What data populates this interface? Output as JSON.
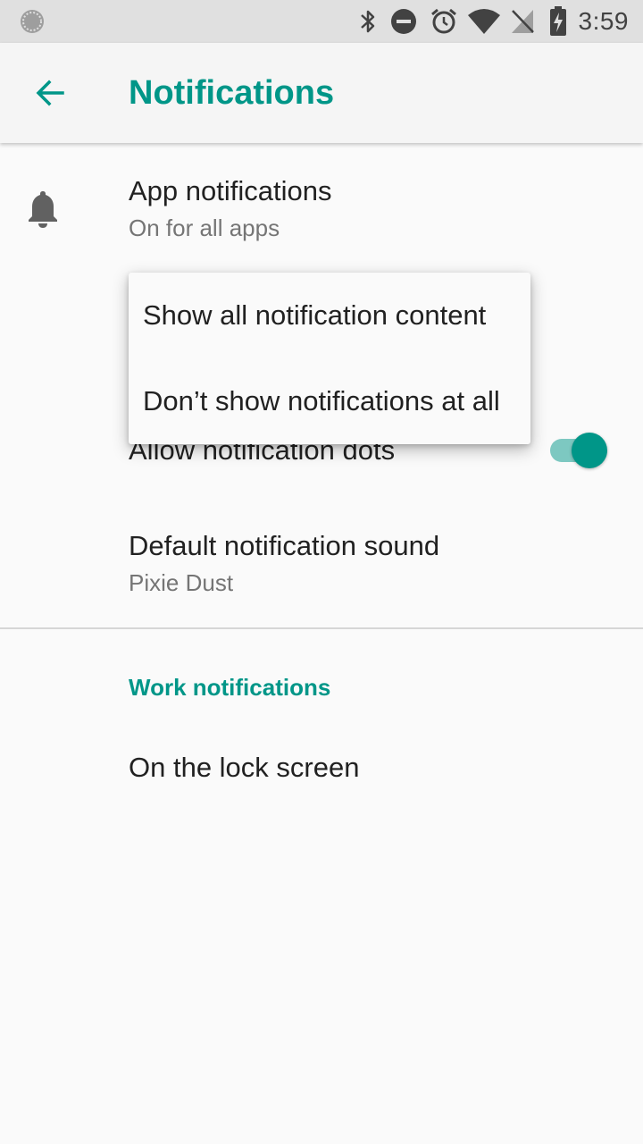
{
  "status_bar": {
    "time": "3:59",
    "icons": [
      "sync-icon",
      "bluetooth-icon",
      "do-not-disturb-icon",
      "alarm-icon",
      "wifi-icon",
      "no-signal-icon",
      "battery-charging-icon"
    ]
  },
  "toolbar": {
    "back_icon": "arrow-back-icon",
    "title": "Notifications"
  },
  "preferences": {
    "app_notifications": {
      "icon": "bell-icon",
      "title": "App notifications",
      "summary": "On for all apps"
    },
    "notification_dots": {
      "title": "Allow notification dots",
      "enabled": true
    },
    "default_sound": {
      "title": "Default notification sound",
      "summary": "Pixie Dust"
    },
    "work_section": {
      "header": "Work notifications",
      "lock_screen_title": "On the lock screen"
    }
  },
  "popup_menu": {
    "items": [
      {
        "label": "Show all notification content"
      },
      {
        "label": "Don’t show notifications at all"
      }
    ]
  },
  "colors": {
    "accent": "#009688",
    "status_bar": "#e0e0e0",
    "toolbar": "#f5f5f5",
    "background": "#fafafa"
  }
}
